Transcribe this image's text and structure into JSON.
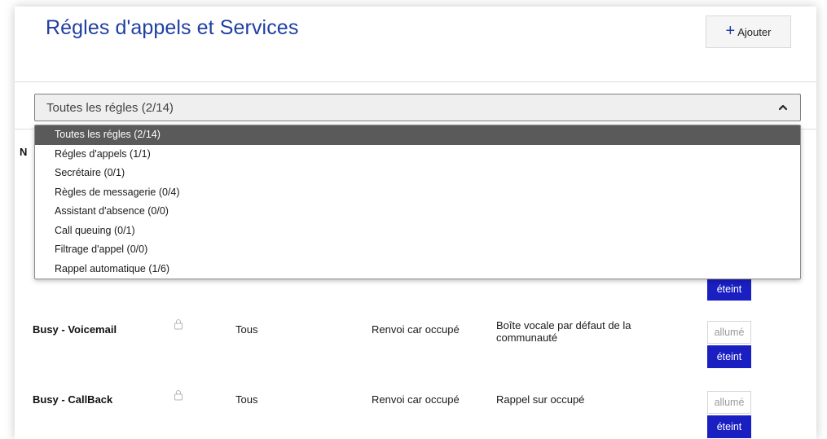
{
  "header": {
    "title": "Régles d'appels et Services",
    "add_button": {
      "icon": "plus-icon",
      "label": "Ajouter"
    }
  },
  "filter": {
    "selected": "Toutes les régles (2/14)",
    "icon": "chevron-up-icon",
    "options": [
      "Toutes les régles (2/14)",
      "Régles d'appels (1/1)",
      "Secrétaire (0/1)",
      "Règles de messagerie (0/4)",
      "Assistant d'absence (0/0)",
      "Call queuing (0/1)",
      "Filtrage d'appel (0/0)",
      "Rappel automatique (1/6)"
    ]
  },
  "table": {
    "header_stub": "N",
    "first_row_partial": {
      "toggle_off": "éteint"
    },
    "rows": [
      {
        "name": "Busy - Voicemail",
        "lock_icon": "lock-icon",
        "scope": "Tous",
        "type": "Renvoi car occupé",
        "destination": "Boîte vocale par défaut de la communauté",
        "toggle_on": "allumé",
        "toggle_off": "éteint"
      },
      {
        "name": "Busy - CallBack",
        "lock_icon": "lock-icon",
        "scope": "Tous",
        "type": "Renvoi car occupé",
        "destination": "Rappel sur occupé",
        "toggle_on": "allumé",
        "toggle_off": "éteint"
      }
    ]
  },
  "colors": {
    "title": "#1f3fa3",
    "toggle_active": "#1a1fc2",
    "dropdown_selected": "#5a5a5a"
  }
}
